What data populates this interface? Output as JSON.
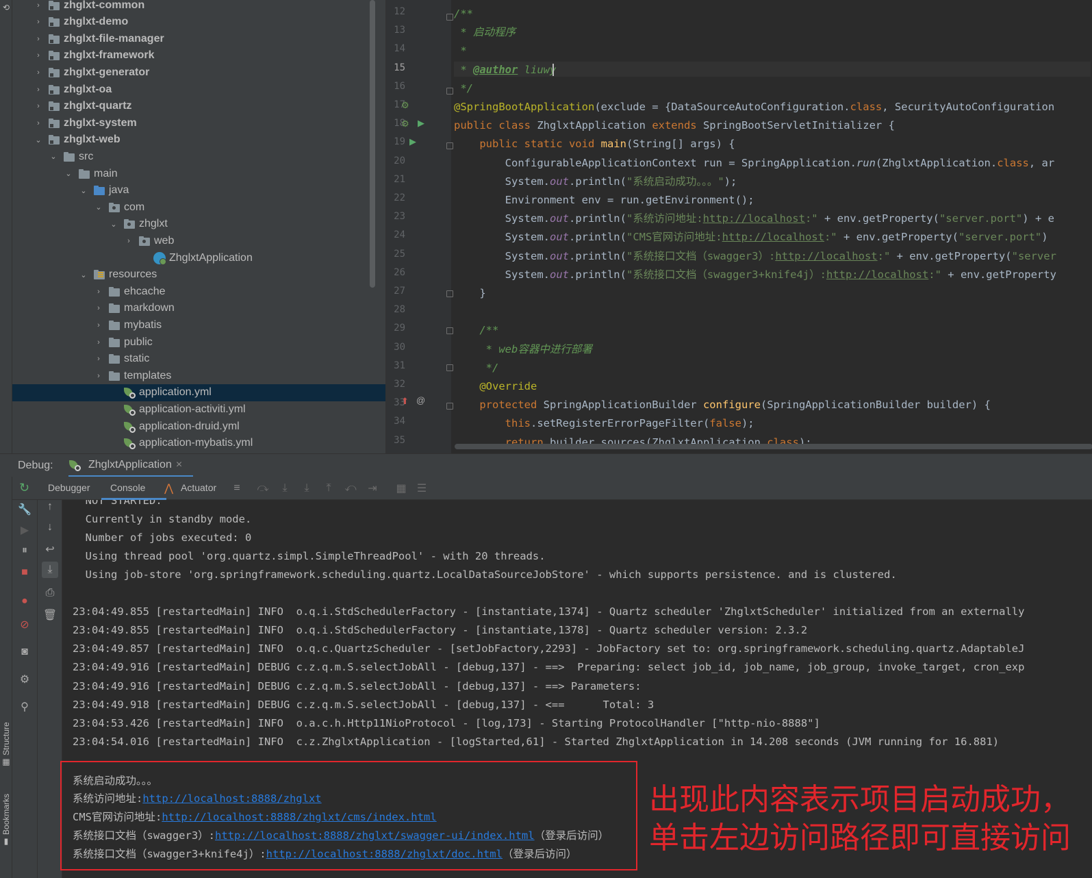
{
  "project_tree": {
    "items": [
      {
        "label": "zhglxt-common",
        "chevron": "›",
        "icon": "module",
        "bold": true
      },
      {
        "label": "zhglxt-demo",
        "chevron": "›",
        "icon": "module",
        "bold": true
      },
      {
        "label": "zhglxt-file-manager",
        "chevron": "›",
        "icon": "module",
        "bold": true
      },
      {
        "label": "zhglxt-framework",
        "chevron": "›",
        "icon": "module",
        "bold": true
      },
      {
        "label": "zhglxt-generator",
        "chevron": "›",
        "icon": "module",
        "bold": true
      },
      {
        "label": "zhglxt-oa",
        "chevron": "›",
        "icon": "module",
        "bold": true
      },
      {
        "label": "zhglxt-quartz",
        "chevron": "›",
        "icon": "module",
        "bold": true
      },
      {
        "label": "zhglxt-system",
        "chevron": "›",
        "icon": "module",
        "bold": true
      },
      {
        "label": "zhglxt-web",
        "chevron": "⌄",
        "icon": "module",
        "bold": true
      },
      {
        "label": "src",
        "chevron": "⌄",
        "icon": "folder"
      },
      {
        "label": "main",
        "chevron": "⌄",
        "icon": "folder"
      },
      {
        "label": "java",
        "chevron": "⌄",
        "icon": "source-folder"
      },
      {
        "label": "com",
        "chevron": "⌄",
        "icon": "package"
      },
      {
        "label": "zhglxt",
        "chevron": "⌄",
        "icon": "package"
      },
      {
        "label": "web",
        "chevron": "›",
        "icon": "package"
      },
      {
        "label": "ZhglxtApplication",
        "chevron": "",
        "icon": "class"
      },
      {
        "label": "resources",
        "chevron": "⌄",
        "icon": "resources"
      },
      {
        "label": "ehcache",
        "chevron": "›",
        "icon": "folder"
      },
      {
        "label": "markdown",
        "chevron": "›",
        "icon": "folder"
      },
      {
        "label": "mybatis",
        "chevron": "›",
        "icon": "folder"
      },
      {
        "label": "public",
        "chevron": "›",
        "icon": "folder"
      },
      {
        "label": "static",
        "chevron": "›",
        "icon": "folder"
      },
      {
        "label": "templates",
        "chevron": "›",
        "icon": "folder"
      },
      {
        "label": "application.yml",
        "chevron": "",
        "icon": "spring-yml",
        "selected": true
      },
      {
        "label": "application-activiti.yml",
        "chevron": "",
        "icon": "spring-yml"
      },
      {
        "label": "application-druid.yml",
        "chevron": "",
        "icon": "spring-yml"
      },
      {
        "label": "application-mybatis.yml",
        "chevron": "",
        "icon": "spring-yml"
      }
    ]
  },
  "editor": {
    "line_numbers": [
      "12",
      "13",
      "14",
      "15",
      "16",
      "17",
      "18",
      "19",
      "20",
      "21",
      "22",
      "23",
      "24",
      "25",
      "26",
      "27",
      "28",
      "29",
      "30",
      "31",
      "32",
      "33",
      "34",
      "35"
    ],
    "current_line": "15",
    "lines": [
      [
        {
          "t": "/**",
          "c": "cm"
        }
      ],
      [
        {
          "t": " * 启动程序",
          "c": "cm"
        }
      ],
      [
        {
          "t": " *",
          "c": "cm"
        }
      ],
      [
        {
          "t": " * ",
          "c": "cm"
        },
        {
          "t": "@author",
          "c": "tag"
        },
        {
          "t": " liuwy",
          "c": "cm"
        }
      ],
      [
        {
          "t": " */",
          "c": "cm"
        }
      ],
      [
        {
          "t": "@SpringBootApplication",
          "c": "an"
        },
        {
          "t": "(exclude = {DataSourceAutoConfiguration.",
          "c": ""
        },
        {
          "t": "class",
          "c": "kw"
        },
        {
          "t": ", SecurityAutoConfiguration",
          "c": ""
        }
      ],
      [
        {
          "t": "public class ",
          "c": "kw"
        },
        {
          "t": "ZhglxtApplication ",
          "c": ""
        },
        {
          "t": "extends ",
          "c": "kw"
        },
        {
          "t": "SpringBootServletInitializer {",
          "c": ""
        }
      ],
      [
        {
          "t": "    public static void ",
          "c": "kw"
        },
        {
          "t": "main",
          "c": "fn"
        },
        {
          "t": "(String[] args) {",
          "c": ""
        }
      ],
      [
        {
          "t": "        ConfigurableApplicationContext run = SpringApplication.",
          "c": ""
        },
        {
          "t": "run",
          "c": "it2"
        },
        {
          "t": "(ZhglxtApplication.",
          "c": ""
        },
        {
          "t": "class",
          "c": "kw"
        },
        {
          "t": ", ar",
          "c": ""
        }
      ],
      [
        {
          "t": "        System.",
          "c": ""
        },
        {
          "t": "out",
          "c": "it"
        },
        {
          "t": ".println(",
          "c": ""
        },
        {
          "t": "\"系统启动成功。。。\"",
          "c": "str"
        },
        {
          "t": ");",
          "c": ""
        }
      ],
      [
        {
          "t": "        Environment env = run.getEnvironment();",
          "c": ""
        }
      ],
      [
        {
          "t": "        System.",
          "c": ""
        },
        {
          "t": "out",
          "c": "it"
        },
        {
          "t": ".println(",
          "c": ""
        },
        {
          "t": "\"系统访问地址:",
          "c": "str"
        },
        {
          "t": "http://localhost",
          "c": "slnk"
        },
        {
          "t": ":\"",
          "c": "str"
        },
        {
          "t": " + env.getProperty(",
          "c": ""
        },
        {
          "t": "\"server.port\"",
          "c": "str"
        },
        {
          "t": ") + e",
          "c": ""
        }
      ],
      [
        {
          "t": "        System.",
          "c": ""
        },
        {
          "t": "out",
          "c": "it"
        },
        {
          "t": ".println(",
          "c": ""
        },
        {
          "t": "\"CMS官网访问地址:",
          "c": "str"
        },
        {
          "t": "http://localhost",
          "c": "slnk"
        },
        {
          "t": ":\"",
          "c": "str"
        },
        {
          "t": " + env.getProperty(",
          "c": ""
        },
        {
          "t": "\"server.port\"",
          "c": "str"
        },
        {
          "t": ")",
          "c": ""
        }
      ],
      [
        {
          "t": "        System.",
          "c": ""
        },
        {
          "t": "out",
          "c": "it"
        },
        {
          "t": ".println(",
          "c": ""
        },
        {
          "t": "\"系统接口文档（swagger3）:",
          "c": "str"
        },
        {
          "t": "http://localhost",
          "c": "slnk"
        },
        {
          "t": ":\"",
          "c": "str"
        },
        {
          "t": " + env.getProperty(",
          "c": ""
        },
        {
          "t": "\"server",
          "c": "str"
        }
      ],
      [
        {
          "t": "        System.",
          "c": ""
        },
        {
          "t": "out",
          "c": "it"
        },
        {
          "t": ".println(",
          "c": ""
        },
        {
          "t": "\"系统接口文档（swagger3+knife4j）:",
          "c": "str"
        },
        {
          "t": "http://localhost",
          "c": "slnk"
        },
        {
          "t": ":\"",
          "c": "str"
        },
        {
          "t": " + env.getProperty",
          "c": ""
        }
      ],
      [
        {
          "t": "    }",
          "c": ""
        }
      ],
      [
        {
          "t": "",
          "c": ""
        }
      ],
      [
        {
          "t": "    /**",
          "c": "cm"
        }
      ],
      [
        {
          "t": "     * web容器中进行部署",
          "c": "cm"
        }
      ],
      [
        {
          "t": "     */",
          "c": "cm"
        }
      ],
      [
        {
          "t": "    @Override",
          "c": "an"
        }
      ],
      [
        {
          "t": "    protected ",
          "c": "kw"
        },
        {
          "t": "SpringApplicationBuilder ",
          "c": ""
        },
        {
          "t": "configure",
          "c": "fn"
        },
        {
          "t": "(SpringApplicationBuilder builder) {",
          "c": ""
        }
      ],
      [
        {
          "t": "        this",
          "c": "kw"
        },
        {
          "t": ".setRegisterErrorPageFilter(",
          "c": ""
        },
        {
          "t": "false",
          "c": "kw"
        },
        {
          "t": ");",
          "c": ""
        }
      ],
      [
        {
          "t": "        return ",
          "c": "kw"
        },
        {
          "t": "builder.sources(ZhglxtApplication.",
          "c": ""
        },
        {
          "t": "class",
          "c": "kw"
        },
        {
          "t": ");",
          "c": ""
        }
      ]
    ]
  },
  "debug": {
    "title": "Debug:",
    "tab_label": "ZhglxtApplication",
    "tab_close": "×",
    "tabs": [
      "Debugger",
      "Console",
      "Actuator"
    ],
    "active_tab": "Console"
  },
  "side_tabs": {
    "structure": "Structure",
    "bookmarks": "Bookmarks"
  },
  "console": {
    "lines": [
      "  NOT STARTED.",
      "  Currently in standby mode.",
      "  Number of jobs executed: 0",
      "  Using thread pool 'org.quartz.simpl.SimpleThreadPool' - with 20 threads.",
      "  Using job-store 'org.springframework.scheduling.quartz.LocalDataSourceJobStore' - which supports persistence. and is clustered.",
      "",
      "23:04:49.855 [restartedMain] INFO  o.q.i.StdSchedulerFactory - [instantiate,1374] - Quartz scheduler 'ZhglxtScheduler' initialized from an externally",
      "23:04:49.855 [restartedMain] INFO  o.q.i.StdSchedulerFactory - [instantiate,1378] - Quartz scheduler version: 2.3.2",
      "23:04:49.857 [restartedMain] INFO  o.q.c.QuartzScheduler - [setJobFactory,2293] - JobFactory set to: org.springframework.scheduling.quartz.AdaptableJ",
      "23:04:49.916 [restartedMain] DEBUG c.z.q.m.S.selectJobAll - [debug,137] - ==>  Preparing: select job_id, job_name, job_group, invoke_target, cron_exp",
      "23:04:49.916 [restartedMain] DEBUG c.z.q.m.S.selectJobAll - [debug,137] - ==> Parameters: ",
      "23:04:49.918 [restartedMain] DEBUG c.z.q.m.S.selectJobAll - [debug,137] - <==      Total: 3",
      "23:04:53.426 [restartedMain] INFO  o.a.c.h.Http11NioProtocol - [log,173] - Starting ProtocolHandler [\"http-nio-8888\"]",
      "23:04:54.016 [restartedMain] INFO  c.z.ZhglxtApplication - [logStarted,61] - Started ZhglxtApplication in 14.208 seconds (JVM running for 16.881)"
    ],
    "success_line": "系统启动成功。。。",
    "url_lines": [
      {
        "prefix": "系统访问地址:",
        "url": "http://localhost:8888/zhglxt",
        "suffix": ""
      },
      {
        "prefix": "CMS官网访问地址:",
        "url": "http://localhost:8888/zhglxt/cms/index.html",
        "suffix": ""
      },
      {
        "prefix": "系统接口文档（swagger3）:",
        "url": "http://localhost:8888/zhglxt/swagger-ui/index.html",
        "suffix": "（登录后访问）"
      },
      {
        "prefix": "系统接口文档（swagger3+knife4j）:",
        "url": "http://localhost:8888/zhglxt/doc.html",
        "suffix": "（登录后访问）"
      }
    ]
  },
  "annotation": {
    "line1": "出现此内容表示项目启动成功，",
    "line2": "单击左边访问路径即可直接访问",
    "color": "#e2262c"
  },
  "colors": {
    "accent": "#287bde",
    "selection": "#0d293e",
    "panel": "#3c3f41",
    "editor_bg": "#2b2b2b"
  }
}
